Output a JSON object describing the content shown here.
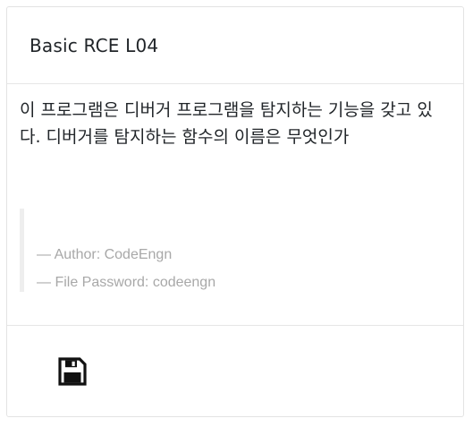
{
  "challenge": {
    "title": "Basic RCE L04",
    "description": "이 프로그램은 디버거 프로그램을 탐지하는 기능을 갖고 있다. 디버거를 탐지하는 함수의 이름은 무엇인가",
    "author_line": "— Author: CodeEngn",
    "password_line": "— File Password: codeengn"
  },
  "footer": {
    "download_icon": "floppy-disk-icon"
  },
  "colors": {
    "text": "#212529",
    "muted": "#a8a8a8",
    "border": "#e3e3e3"
  }
}
